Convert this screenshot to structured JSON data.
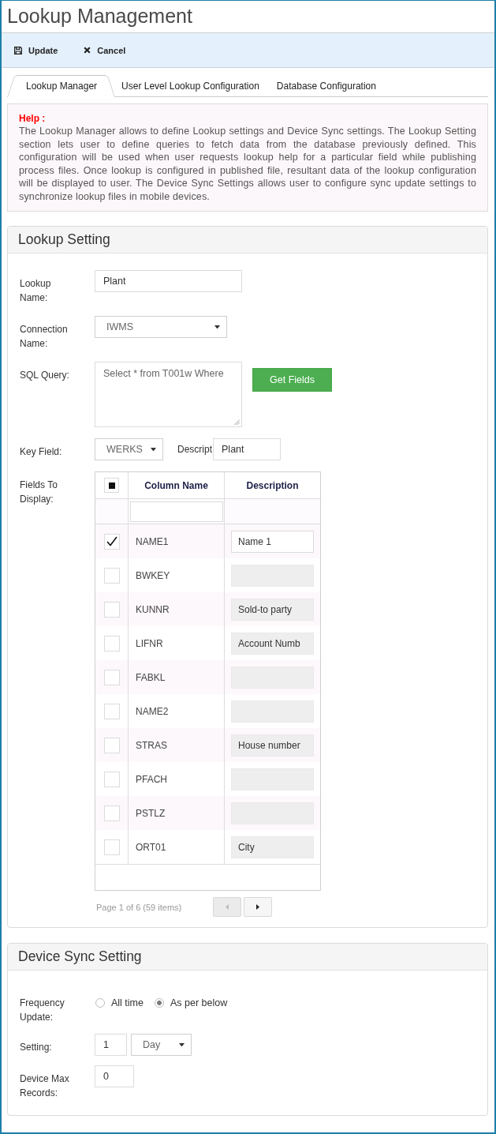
{
  "window": {
    "title": "Lookup Management"
  },
  "toolbar": [
    {
      "kind": "save",
      "label": "Update"
    },
    {
      "kind": "cancel",
      "label": "Cancel"
    }
  ],
  "tabs": [
    {
      "label": "Lookup Manager",
      "selected": true
    },
    {
      "label": "User Level Lookup Configuration",
      "selected": false
    },
    {
      "label": "Database Configuration",
      "selected": false
    }
  ],
  "help": {
    "title": "Help :",
    "text": "The Lookup Manager allows to define Lookup settings and Device Sync settings. The Lookup Setting section lets user to define queries to fetch data from the database previously defined. This configuration will be used when user requests lookup help for a particular field while publishing process files. Once lookup is configured in published file, resultant data of the lookup configuration will be displayed to user. The Device Sync Settings allows user to configure sync update settings to synchronize lookup files in mobile devices."
  },
  "lookup_setting": {
    "title": "Lookup Setting",
    "lookup_name": {
      "label": "Lookup Name:",
      "value": "Plant"
    },
    "connection_name": {
      "label": "Connection Name:",
      "value": "IWMS"
    },
    "sql_query": {
      "label": "SQL Query:",
      "value": "Select * from T001w Where",
      "button": "Get Fields"
    },
    "key_field": {
      "label": "Key Field:",
      "value": "WERKS",
      "description_label": "Descript",
      "description_value": "Plant"
    },
    "fields_to_display": {
      "label": "Fields To Display:",
      "select_all": {
        "indeterminate": true
      },
      "columns": [
        "Column Name",
        "Description"
      ],
      "rows": [
        {
          "name": "NAME1",
          "checked": true,
          "description": "Name 1"
        },
        {
          "name": "BWKEY",
          "checked": false
        },
        {
          "name": "KUNNR",
          "checked": false,
          "description": "Sold-to party"
        },
        {
          "name": "LIFNR",
          "checked": false,
          "description": "Account Numb"
        },
        {
          "name": "FABKL",
          "checked": false
        },
        {
          "name": "NAME2",
          "checked": false
        },
        {
          "name": "STRAS",
          "checked": false,
          "description": "House number"
        },
        {
          "name": "PFACH",
          "checked": false
        },
        {
          "name": "PSTLZ",
          "checked": false
        },
        {
          "name": "ORT01",
          "checked": false,
          "description": "City"
        }
      ],
      "pager": {
        "summary": "Page 1 of 6 (59 items)",
        "buttons": [
          {
            "kind": "prev",
            "disabled": true
          },
          {
            "kind": "next",
            "disabled": false
          }
        ]
      }
    }
  },
  "device_sync_setting": {
    "title": "Device Sync Setting",
    "frequency_update": {
      "label": "Frequency Update:",
      "options": [
        {
          "label": "All time",
          "selected": false
        },
        {
          "label": "As per below",
          "selected": true
        }
      ]
    },
    "setting": {
      "label": "Setting:",
      "value": "1",
      "unit": "Day"
    },
    "device_max_records": {
      "label": "Device Max Records:",
      "value": "0"
    }
  }
}
